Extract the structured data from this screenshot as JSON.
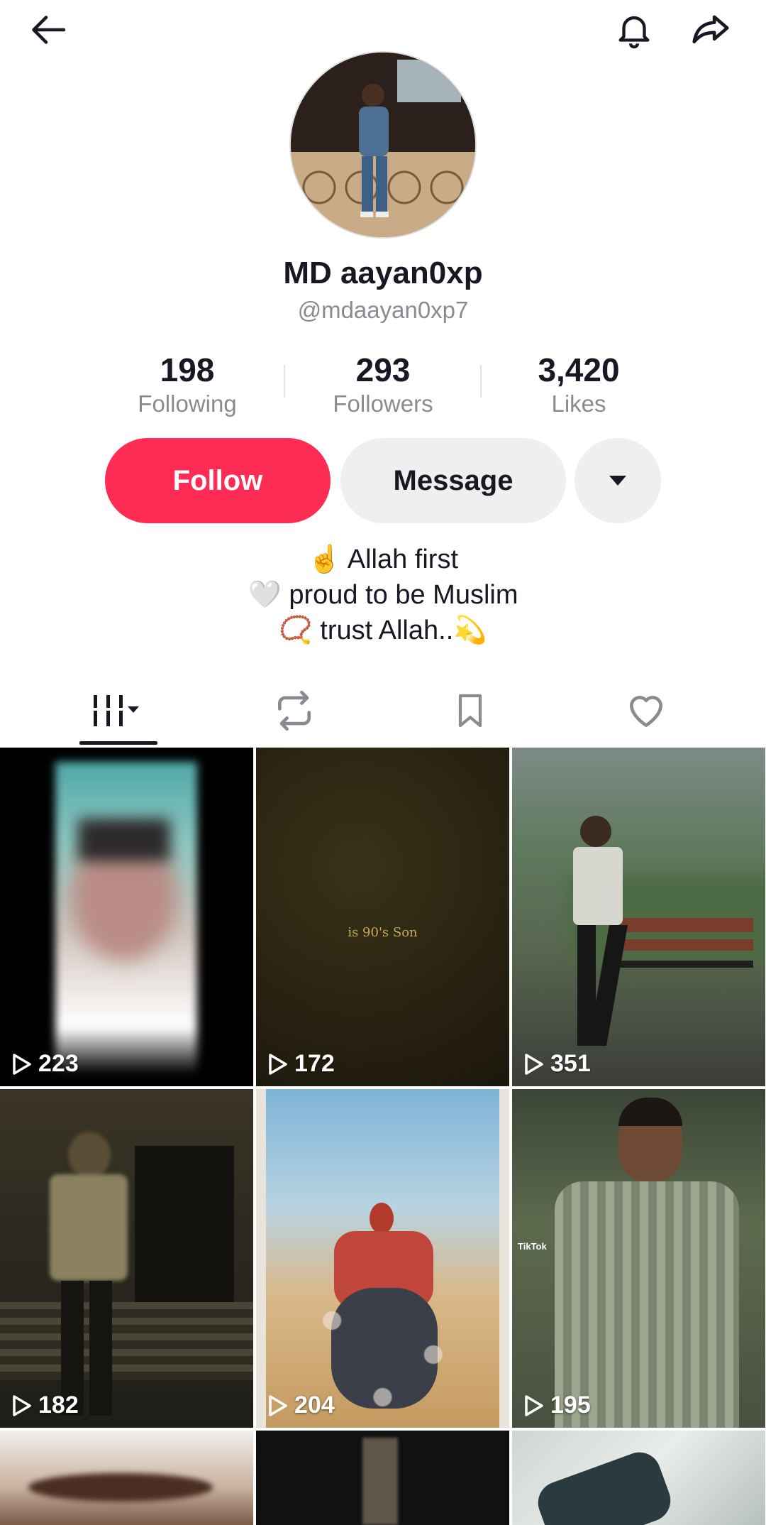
{
  "profile": {
    "display_name": "MD aayan0xp",
    "username": "@mdaayan0xp7"
  },
  "stats": [
    {
      "value": "198",
      "label": "Following"
    },
    {
      "value": "293",
      "label": "Followers"
    },
    {
      "value": "3,420",
      "label": "Likes"
    }
  ],
  "actions": {
    "follow_label": "Follow",
    "message_label": "Message"
  },
  "bio": {
    "line1": "☝️ Allah first",
    "line2": "🤍 proud to be Muslim",
    "line3": "📿 trust Allah..💫"
  },
  "tabs": [
    "videos-grid-icon",
    "reposts-icon",
    "saved-icon",
    "liked-icon"
  ],
  "videos": [
    {
      "views": "223"
    },
    {
      "views": "172",
      "caption": "is 90's Son"
    },
    {
      "views": "351"
    },
    {
      "views": "182"
    },
    {
      "views": "204"
    },
    {
      "views": "195",
      "watermark": "TikTok"
    }
  ],
  "colors": {
    "accent": "#fe2c55",
    "text": "#161823",
    "muted": "#8a8b91",
    "button_gray": "#efefef"
  }
}
